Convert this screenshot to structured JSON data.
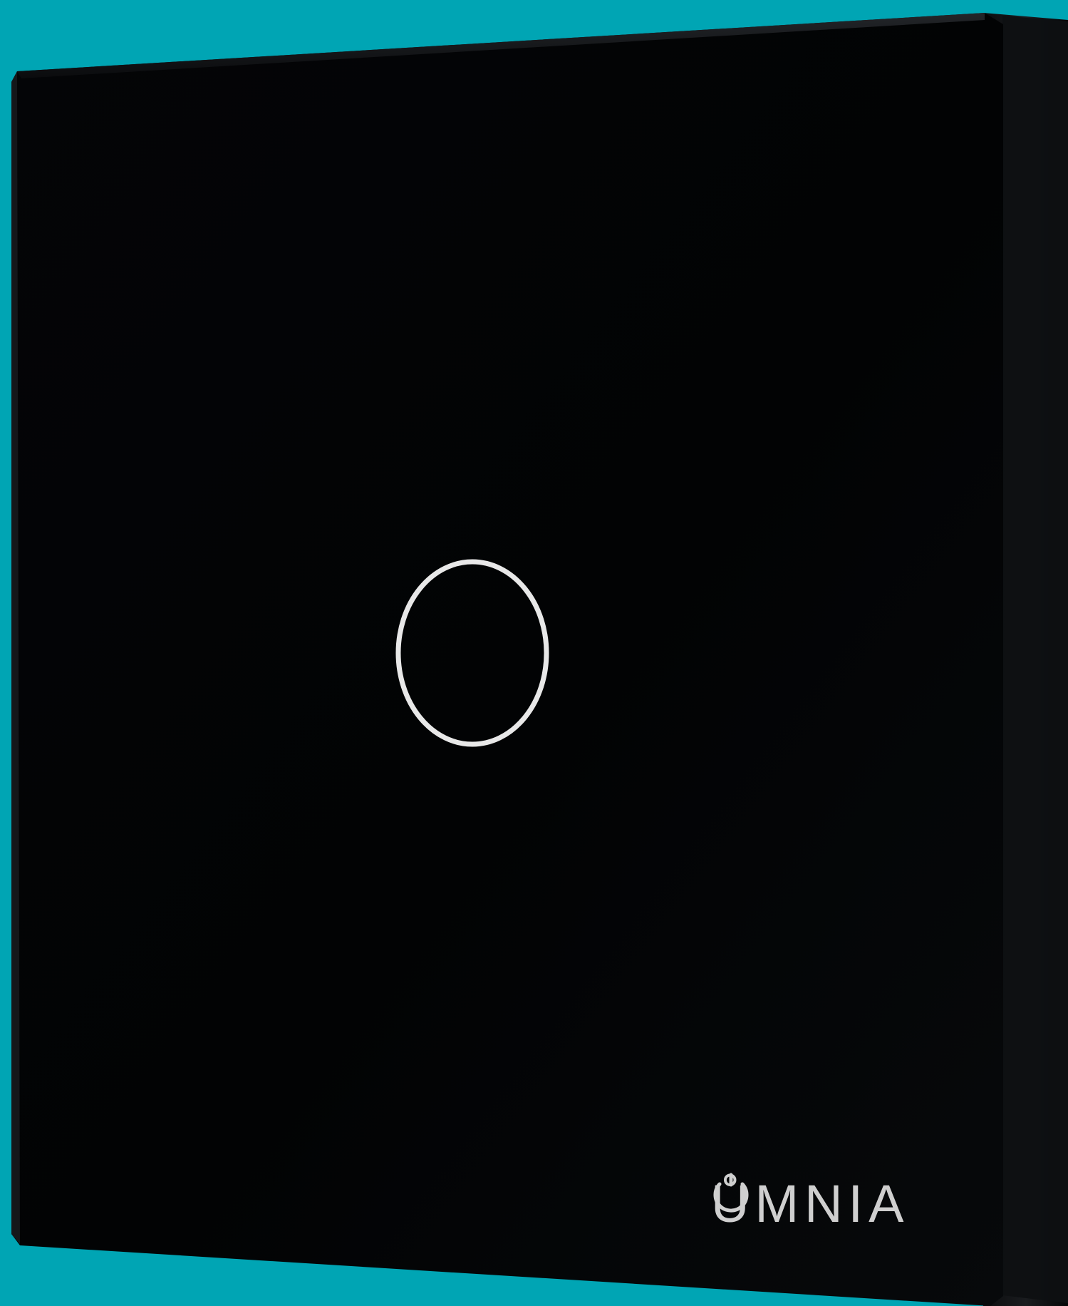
{
  "scene": {
    "background_color": "#00a5b4",
    "panel_color": "#050608",
    "ring_color": "#e8e8e8",
    "logo_color": "#cfcfcf"
  },
  "logo": {
    "text": "ŮMNIA",
    "icon": "power-icon"
  },
  "touch_button": {
    "icon": "ring-icon",
    "state": "illuminated"
  }
}
